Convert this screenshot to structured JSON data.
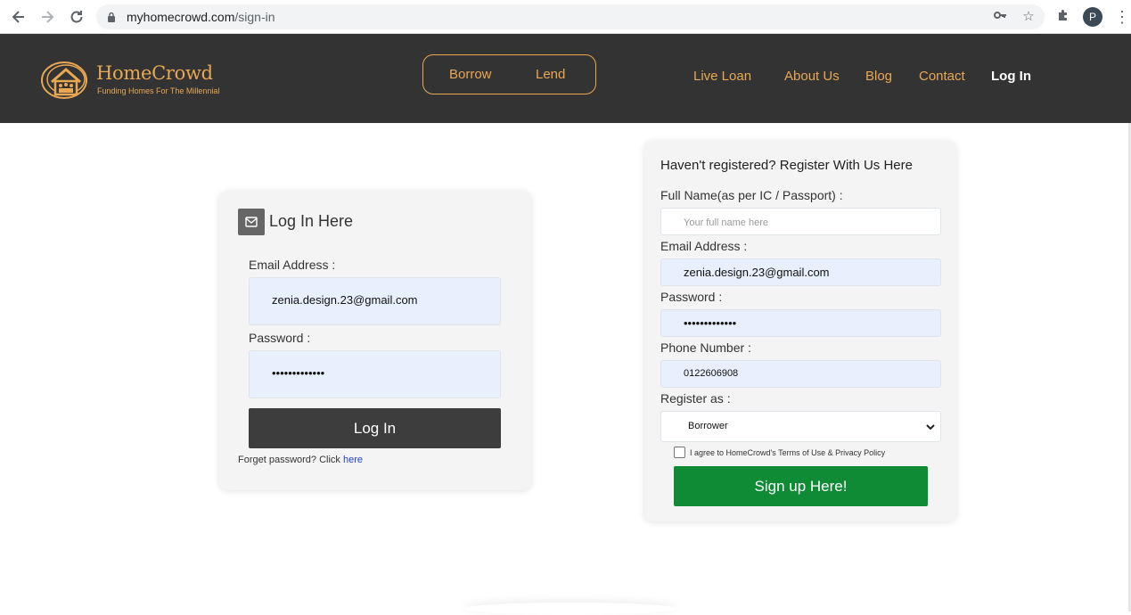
{
  "browser": {
    "url_host": "myhomecrowd.com",
    "url_path": "/sign-in",
    "profile_initial": "P",
    "icons": [
      "back-arrow-icon",
      "forward-arrow-icon",
      "reload-icon",
      "lock-icon",
      "key-icon",
      "star-icon",
      "puzzle-icon",
      "kebab-menu-icon"
    ]
  },
  "brand": {
    "name": "HomeCrowd",
    "tagline": "Funding Homes For The Millennial",
    "accent_color": "#e8a853",
    "header_bg": "#333333"
  },
  "header": {
    "borrow": "Borrow",
    "lend": "Lend",
    "nav": [
      "Live Loan",
      "About Us",
      "Blog",
      "Contact",
      "Log In"
    ],
    "active_nav": "Log In"
  },
  "login": {
    "title": "Log In Here",
    "email_label": "Email Address :",
    "email_value": "zenia.design.23@gmail.com",
    "password_label": "Password :",
    "password_value": "•••••••••••••",
    "button": "Log In",
    "forgot_text": "Forget password? Click ",
    "forgot_link": "here"
  },
  "register": {
    "title": "Haven't registered? Register With Us Here",
    "fullname_label": "Full Name(as per IC / Passport) :",
    "fullname_placeholder": "Your full name here",
    "email_label": "Email Address :",
    "email_value": "zenia.design.23@gmail.com",
    "password_label": "Password :",
    "password_value": "•••••••••••••",
    "phone_label": "Phone Number :",
    "phone_value": "0122606908",
    "register_as_label": "Register as :",
    "register_as_value": "Borrower",
    "agree_text": "I agree to HomeCrowd's Terms of Use & Privacy Policy",
    "button": "Sign up Here!",
    "button_color": "#0f8a35"
  }
}
